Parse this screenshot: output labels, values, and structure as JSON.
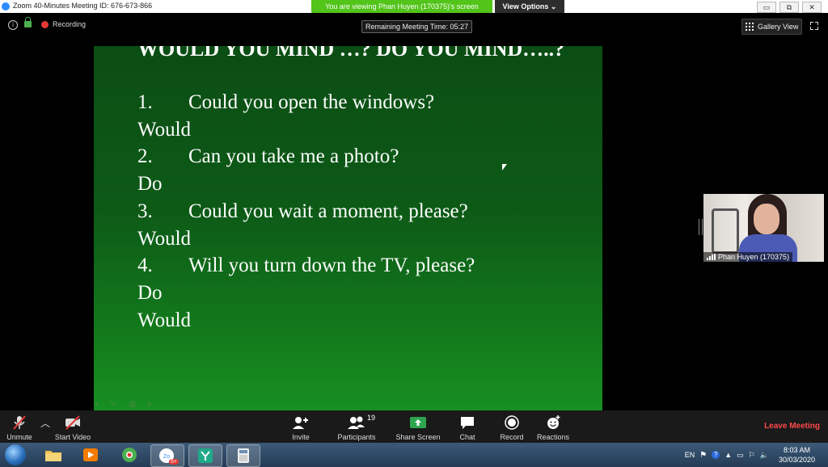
{
  "window": {
    "title": "Zoom 40-Minutes Meeting ID: 676-673-866",
    "viewing_banner": "You are viewing Phan Huyen (170375)'s screen",
    "view_options": "View Options ⌄",
    "minimize": "▭",
    "restore": "⧉",
    "close": "✕"
  },
  "topbar": {
    "recording": "Recording",
    "remaining_time": "Remaining Meeting Time: 05:27",
    "gallery_view": "Gallery View"
  },
  "slide": {
    "title": "WOULD YOU MIND …? DO YOU MIND…..?",
    "lines": [
      {
        "num": "1.",
        "text": "Could you open the windows?"
      },
      {
        "text": "Would"
      },
      {
        "num": "2.",
        "text": "Can you take me a photo?"
      },
      {
        "text": "Do"
      },
      {
        "num": "3.",
        "text": "Could you wait a moment, please?"
      },
      {
        "text": "Would"
      },
      {
        "num": "4.",
        "text": "Will you turn down the TV, please?"
      },
      {
        "text": "Do"
      },
      {
        "text": "Would"
      }
    ]
  },
  "participant": {
    "name": "Phan Huyen (170375)"
  },
  "toolbar": {
    "unmute": "Unmute",
    "start_video": "Start Video",
    "invite": "Invite",
    "participants": "Participants",
    "participants_count": "19",
    "share_screen": "Share Screen",
    "chat": "Chat",
    "record": "Record",
    "reactions": "Reactions",
    "leave": "Leave Meeting"
  },
  "taskbar": {
    "language": "EN",
    "time": "8:03 AM",
    "date": "30/03/2020",
    "zoom_badge": "5+"
  },
  "colors": {
    "share_banner": "#52c41a",
    "leave": "#ff4a4a",
    "slide_green": "#0d5a17"
  }
}
